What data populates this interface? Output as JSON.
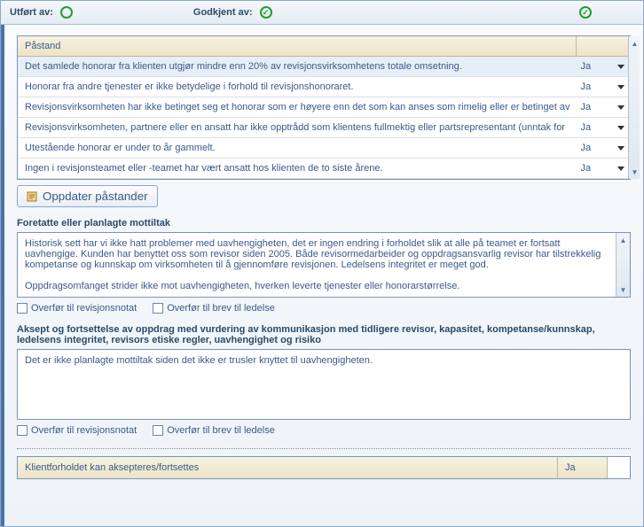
{
  "topbar": {
    "performed_label": "Utført av:",
    "approved_label": "Godkjent av:"
  },
  "table": {
    "header_statement": "Påstand",
    "rows": [
      {
        "statement": "Det samlede honorar fra klienten utgjør mindre enn 20% av revisjonsvirksomhetens totale omsetning.",
        "answer": "Ja",
        "selected": true
      },
      {
        "statement": "Honorar fra andre tjenester er ikke betydelige i forhold til revisjonshonoraret.",
        "answer": "Ja",
        "selected": false
      },
      {
        "statement": "Revisjonsvirksomheten har ikke betinget seg et honorar som er høyere enn det som kan anses som rimelig eller er betinget av",
        "answer": "Ja",
        "selected": false
      },
      {
        "statement": "Revisjonsvirksomheten, partnere eller en ansatt har ikke opptrådd som klientens fullmektig eller partsrepresentant (unntak for",
        "answer": "Ja",
        "selected": false
      },
      {
        "statement": "Utestående honorar er under to år gammelt.",
        "answer": "Ja",
        "selected": false
      },
      {
        "statement": "Ingen i revisjonsteamet eller -teamet har vært ansatt hos klienten de to siste årene.",
        "answer": "Ja",
        "selected": false
      }
    ]
  },
  "buttons": {
    "update_statements": "Oppdater påstander"
  },
  "section1": {
    "title": "Foretatte eller planlagte mottiltak",
    "text": "Historisk sett har vi ikke hatt problemer med uavhengigheten, det er ingen endring i forholdet slik at alle på teamet er fortsatt uavhengige. Kunden har benyttet oss som revisor siden 2005. Både revisormedarbeider og oppdragsansvarlig revisor har tilstrekkelig kompetanse og kunnskap om virksomheten til å gjennomføre revisjonen. Ledelsens integritet er meget god.\n\nOppdragsomfanget strider ikke mot uavhengigheten, hverken leverte tjenester eller honorarstørrelse."
  },
  "checkboxes": {
    "transfer_note": "Overfør til revisjonsnotat",
    "transfer_letter": "Overfør til brev til ledelse"
  },
  "section2": {
    "title": "Aksept og fortsettelse av oppdrag med vurdering av kommunikasjon med tidligere revisor, kapasitet, kompetanse/kunnskap, ledelsens integritet, revisors etiske regler, uavhengighet og risiko",
    "text": "Det er ikke planlagte mottiltak siden det ikke er trusler knyttet til uavhengigheten."
  },
  "footer": {
    "label": "Klientforholdet kan aksepteres/fortsettes",
    "answer": "Ja"
  }
}
